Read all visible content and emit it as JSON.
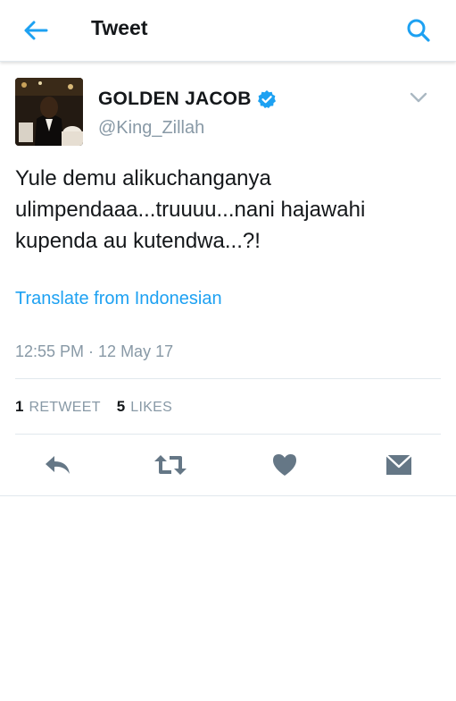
{
  "header": {
    "title": "Tweet",
    "back_icon": "arrow-left-icon",
    "search_icon": "search-icon"
  },
  "author": {
    "display_name": "GOLDEN JACOB",
    "handle": "@King_Zillah",
    "verified": true
  },
  "tweet": {
    "text": "Yule demu alikuchanganya\nulimpendaaa...truuuu...nani hajawahi\nkupenda au kutendwa...?!",
    "translate_link": "Translate from Indonesian",
    "timestamp": "12:55 PM · 12 May 17"
  },
  "stats": {
    "retweets_count": "1",
    "retweets_label": "RETWEET",
    "likes_count": "5",
    "likes_label": "LIKES"
  },
  "actions": [
    "reply-icon",
    "retweet-icon",
    "like-icon",
    "message-icon"
  ],
  "colors": {
    "accent": "#1da1f2",
    "muted": "#8899a6",
    "action_icon": "#657786"
  }
}
